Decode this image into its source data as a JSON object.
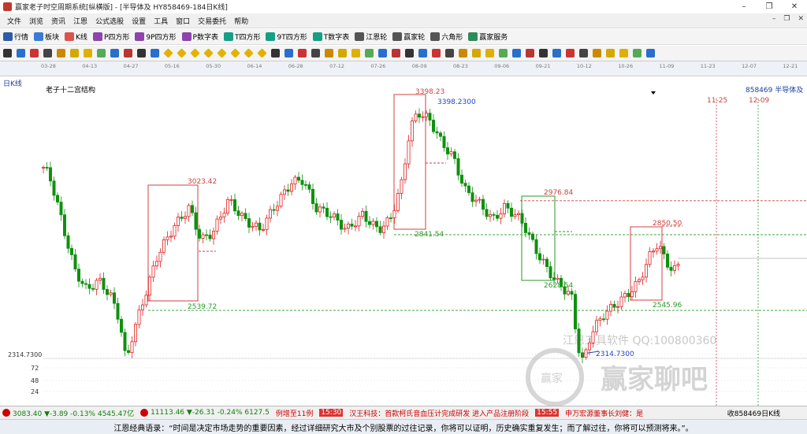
{
  "window": {
    "title": "赢家老子时空周期系统[纵横版] - [半导体及  HY858469-184日K线]",
    "buttons": [
      "–",
      "❐",
      "✕"
    ]
  },
  "menu": {
    "items": [
      "文件",
      "浏览",
      "资讯",
      "江恩",
      "公式选股",
      "设置",
      "工具",
      "窗口",
      "交易委托",
      "帮助"
    ],
    "mdi": [
      "–",
      "❐",
      "✕"
    ]
  },
  "toolbar": {
    "items": [
      {
        "label": "行情",
        "icon": "market-icon",
        "color": "#2e5aa8"
      },
      {
        "label": "板块",
        "icon": "sector-icon",
        "color": "#3a7bd5"
      },
      {
        "label": "K线",
        "icon": "kline-icon",
        "color": "#d9534f"
      },
      {
        "label": "P四方形",
        "icon": "p-square-icon",
        "color": "#8e44ad"
      },
      {
        "label": "9P四方形",
        "icon": "9p-square-icon",
        "color": "#8e44ad"
      },
      {
        "label": "P数字表",
        "icon": "p-table-icon",
        "color": "#8e44ad"
      },
      {
        "label": "T四方形",
        "icon": "t-square-icon",
        "color": "#16a085"
      },
      {
        "label": "9T四方形",
        "icon": "9t-square-icon",
        "color": "#16a085"
      },
      {
        "label": "T数字表",
        "icon": "t-table-icon",
        "color": "#16a085"
      },
      {
        "label": "江恩轮",
        "icon": "gann-wheel-icon",
        "color": "#555"
      },
      {
        "label": "赢家轮",
        "icon": "winner-wheel-icon",
        "color": "#555"
      },
      {
        "label": "六角形",
        "icon": "hexagon-icon",
        "color": "#555"
      },
      {
        "label": "赢家服务",
        "icon": "service-icon",
        "color": "#2e8b57"
      }
    ]
  },
  "toolbar2": {
    "icons": [
      "grid-icon",
      "draw-icon",
      "zoom-icon",
      "kline-type-icon",
      "ma-icon",
      "bar-icon",
      "tick-icon",
      "cursor-icon",
      "arrow-left-icon",
      "arrow-right-icon",
      "first-icon",
      "last-icon",
      "diamond-icon",
      "diamond-icon",
      "diamond-icon",
      "diamond-icon",
      "diamond-icon",
      "diamond-icon",
      "diamond-icon",
      "diamond-icon",
      "hand-icon",
      "cross-icon",
      "line-icon",
      "text-icon",
      "fib-icon",
      "circle-icon",
      "gann-fan-icon",
      "square-icon",
      "eraser-icon",
      "lock-icon",
      "save-icon",
      "folder-icon",
      "camera-icon",
      "copy-icon",
      "chart-icon",
      "chart2-icon",
      "wave-icon",
      "cycle-icon",
      "angle-icon",
      "channel-icon",
      "fan-icon",
      "pitch-icon",
      "box-icon",
      "arc-icon",
      "spiral-icon",
      "grid2-icon",
      "table-icon",
      "palette-icon",
      "settings-icon"
    ]
  },
  "dates": [
    "03-28",
    "04-13",
    "04-27",
    "05-16",
    "05-30",
    "06-14",
    "06-28",
    "07-12",
    "07-26",
    "08-09",
    "08-23",
    "09-06",
    "09-21",
    "10-12",
    "10-26",
    "11-09",
    "11-23",
    "12-07",
    "12-21"
  ],
  "chart": {
    "period_label": "日K线",
    "structure_label": "老子十二宫结构",
    "code_label": "858469 半导体及",
    "future_dates": [
      "11-25",
      "12-09"
    ],
    "y_axis": [
      "2314.7300",
      "72",
      "48",
      "24"
    ],
    "price_labels": {
      "p3398": "3398.23",
      "p3398b": "3398.2300",
      "p3023": "3023.42",
      "p2976": "2976.84",
      "p2850": "2850.50",
      "p2841": "2841.54",
      "p2628": "2628.54",
      "p2545": "2545.96",
      "p2539": "2539.72",
      "p2314": "2314.7300"
    },
    "watermark": {
      "vendor": "江恩工具软件 QQ:100800360",
      "logo": "赢家聊吧",
      "seal": "赢家"
    },
    "colors": {
      "up": "#e02020",
      "down": "#109010",
      "box_red": "#d04040",
      "box_green": "#2a9a2a"
    }
  },
  "chart_data": {
    "type": "candlestick",
    "title": "半导体及 HY858469 日K线",
    "x": [
      "03-28",
      "04-13",
      "04-27",
      "05-16",
      "05-30",
      "06-14",
      "06-28",
      "07-12",
      "07-26",
      "08-09",
      "08-23",
      "09-06",
      "09-21",
      "10-12",
      "10-26",
      "11-09"
    ],
    "close": [
      2960,
      2720,
      2450,
      2720,
      2950,
      2900,
      3000,
      2870,
      2930,
      3300,
      3100,
      2930,
      2880,
      2380,
      2600,
      2760
    ],
    "high_mark": 3398.23,
    "low_mark": 2314.73,
    "levels": [
      3023.42,
      2976.84,
      2850.5,
      2841.54,
      2628.54,
      2545.96,
      2539.72
    ]
  },
  "status": {
    "sh_index": "3083.40 ▼-3.89 -0.13% 4545.47亿",
    "sz_index": "11113.46 ▼-26.31 -0.24% 6127.5",
    "news1": "例增至11例",
    "news_time": "15:30",
    "news2": "汉王科技：首款柯氏音血压计完成研发 进入产品注册阶段",
    "news_time2": "15:55",
    "news3": "申万宏源董事长刘健：是",
    "right": "收858469日K线"
  },
  "quote": {
    "text": "江恩经典语录：“时间是决定市场走势的重要因素，经过详细研究大市及个别股票的过往记录，你将可以证明，历史确实重复发生；而了解过往，你将可以预测将来。”。"
  }
}
